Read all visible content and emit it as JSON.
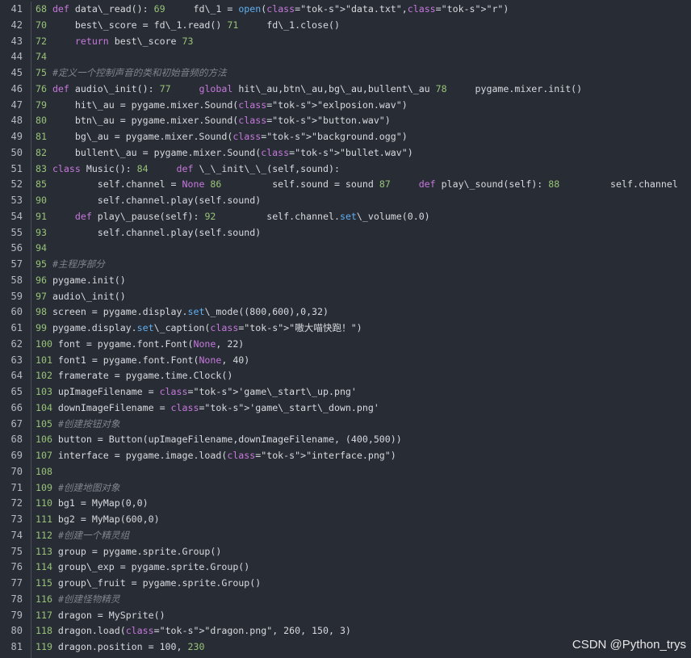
{
  "lines": [
    {
      "no": "41",
      "code": "68 def data\\_read(): 69     fd\\_1 = open(\"data.txt\",\"r\")"
    },
    {
      "no": "42",
      "code": "70     best\\_score = fd\\_1.read() 71     fd\\_1.close()"
    },
    {
      "no": "43",
      "code": "72     return best\\_score 73"
    },
    {
      "no": "44",
      "code": "74"
    },
    {
      "no": "45",
      "code": "75 #定义一个控制声音的类和初始音频的方法"
    },
    {
      "no": "46",
      "code": "76 def audio\\_init(): 77     global hit\\_au,btn\\_au,bg\\_au,bullent\\_au 78     pygame.mixer.init()"
    },
    {
      "no": "47",
      "code": "79     hit\\_au = pygame.mixer.Sound(\"exlposion.wav\")"
    },
    {
      "no": "48",
      "code": "80     btn\\_au = pygame.mixer.Sound(\"button.wav\")"
    },
    {
      "no": "49",
      "code": "81     bg\\_au = pygame.mixer.Sound(\"background.ogg\")"
    },
    {
      "no": "50",
      "code": "82     bullent\\_au = pygame.mixer.Sound(\"bullet.wav\")"
    },
    {
      "no": "51",
      "code": "83 class Music(): 84     def \\_\\_init\\_\\_(self,sound):"
    },
    {
      "no": "52",
      "code": "85         self.channel = None 86         self.sound = sound 87     def play\\_sound(self): 88         self.channel"
    },
    {
      "no": "53",
      "code": "90         self.channel.play(self.sound)"
    },
    {
      "no": "54",
      "code": "91     def play\\_pause(self): 92         self.channel.set\\_volume(0.0)"
    },
    {
      "no": "55",
      "code": "93         self.channel.play(self.sound)"
    },
    {
      "no": "56",
      "code": "94"
    },
    {
      "no": "57",
      "code": "95 #主程序部分"
    },
    {
      "no": "58",
      "code": "96 pygame.init()"
    },
    {
      "no": "59",
      "code": "97 audio\\_init()"
    },
    {
      "no": "60",
      "code": "98 screen = pygame.display.set\\_mode((800,600),0,32)"
    },
    {
      "no": "61",
      "code": "99 pygame.display.set\\_caption(\"嗷大喵快跑！\")"
    },
    {
      "no": "62",
      "code": "100 font = pygame.font.Font(None, 22)"
    },
    {
      "no": "63",
      "code": "101 font1 = pygame.font.Font(None, 40)"
    },
    {
      "no": "64",
      "code": "102 framerate = pygame.time.Clock()"
    },
    {
      "no": "65",
      "code": "103 upImageFilename = 'game\\_start\\_up.png'"
    },
    {
      "no": "66",
      "code": "104 downImageFilename = 'game\\_start\\_down.png'"
    },
    {
      "no": "67",
      "code": "105 #创建按钮对象"
    },
    {
      "no": "68",
      "code": "106 button = Button(upImageFilename,downImageFilename, (400,500))"
    },
    {
      "no": "69",
      "code": "107 interface = pygame.image.load(\"interface.png\")"
    },
    {
      "no": "70",
      "code": "108"
    },
    {
      "no": "71",
      "code": "109 #创建地图对象"
    },
    {
      "no": "72",
      "code": "110 bg1 = MyMap(0,0)"
    },
    {
      "no": "73",
      "code": "111 bg2 = MyMap(600,0)"
    },
    {
      "no": "74",
      "code": "112 #创建一个精灵组"
    },
    {
      "no": "75",
      "code": "113 group = pygame.sprite.Group()"
    },
    {
      "no": "76",
      "code": "114 group\\_exp = pygame.sprite.Group()"
    },
    {
      "no": "77",
      "code": "115 group\\_fruit = pygame.sprite.Group()"
    },
    {
      "no": "78",
      "code": "116 #创建怪物精灵"
    },
    {
      "no": "79",
      "code": "117 dragon = MySprite()"
    },
    {
      "no": "80",
      "code": "118 dragon.load(\"dragon.png\", 260, 150, 3)"
    },
    {
      "no": "81",
      "code": "119 dragon.position = 100, 230"
    }
  ],
  "watermark": "CSDN @Python_trys",
  "colors": {
    "background": "#282c34",
    "gutter_text": "#b5b9c1",
    "code_text": "#d7dae0",
    "keyword": "#c678dd",
    "string": "#98c379",
    "comment": "#7f848e",
    "builtin": "#61afef"
  }
}
